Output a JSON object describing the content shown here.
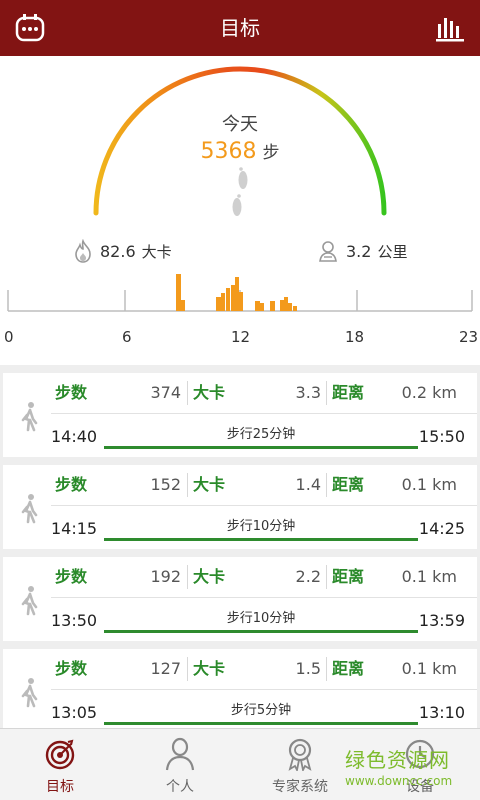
{
  "header": {
    "title": "目标",
    "left_icon": "device-icon",
    "right_icon": "bar-chart-icon"
  },
  "gauge": {
    "today_label": "今天",
    "steps_value": "5368",
    "steps_unit": "步"
  },
  "stats": {
    "calories_value": "82.6",
    "calories_unit": "大卡",
    "distance_value": "3.2",
    "distance_unit": "公里"
  },
  "histogram": {
    "axis_labels": [
      "0",
      "6",
      "12",
      "18",
      "23"
    ],
    "bar_color": "#f39a1c"
  },
  "records": [
    {
      "steps_label": "步数",
      "steps": "374",
      "cal_label": "大卡",
      "cal": "3.3",
      "dist_label": "距离",
      "dist": "0.2 km",
      "start": "14:40",
      "end": "15:50",
      "duration": "步行25分钟"
    },
    {
      "steps_label": "步数",
      "steps": "152",
      "cal_label": "大卡",
      "cal": "1.4",
      "dist_label": "距离",
      "dist": "0.1 km",
      "start": "14:15",
      "end": "14:25",
      "duration": "步行10分钟"
    },
    {
      "steps_label": "步数",
      "steps": "192",
      "cal_label": "大卡",
      "cal": "2.2",
      "dist_label": "距离",
      "dist": "0.1 km",
      "start": "13:50",
      "end": "13:59",
      "duration": "步行10分钟"
    },
    {
      "steps_label": "步数",
      "steps": "127",
      "cal_label": "大卡",
      "cal": "1.5",
      "dist_label": "距离",
      "dist": "0.1 km",
      "start": "13:05",
      "end": "13:10",
      "duration": "步行5分钟"
    }
  ],
  "tabs": [
    {
      "label": "目标",
      "icon": "target-icon",
      "active": true
    },
    {
      "label": "个人",
      "icon": "person-icon",
      "active": false
    },
    {
      "label": "专家系统",
      "icon": "award-icon",
      "active": false
    },
    {
      "label": "设备",
      "icon": "clock-icon",
      "active": false
    }
  ],
  "watermark": {
    "text": "绿色资源网",
    "url": "www.downcc.com"
  },
  "colors": {
    "header_bg": "#821413",
    "accent_orange": "#f39a1c",
    "label_green": "#2a8a2a",
    "bar_green": "#2e8b2e"
  }
}
